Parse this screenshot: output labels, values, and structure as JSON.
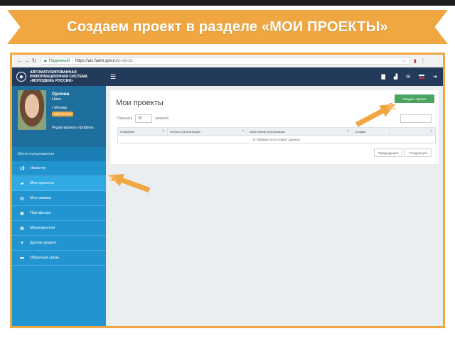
{
  "banner": {
    "title": "Создаем проект в разделе «МОИ ПРОЕКТЫ»"
  },
  "browser": {
    "secure_label": "Надежный",
    "url_host": "https://ais.fadm.gov.ru",
    "url_path": "/projects"
  },
  "app": {
    "brand_line1": "АВТОМАТИЗИРОВАННАЯ",
    "brand_line2": "ИНФОРМАЦИОННАЯ СИСТЕМА",
    "brand_line3": "«МОЛОДЕЖЬ РОССИИ»"
  },
  "profile": {
    "last_name": "Орлова",
    "first_name": "Нина",
    "city": "г Москва",
    "points": "250 баллов",
    "edit_link": "Редактировать профиль"
  },
  "sidebar": {
    "menu_header": "Меню пользователя",
    "items": [
      {
        "label": "Новости",
        "icon": "megaphone-icon"
      },
      {
        "label": "Мои проекты",
        "icon": "folder-icon",
        "active": true
      },
      {
        "label": "Мои заявки",
        "icon": "document-icon"
      },
      {
        "label": "Портфолио",
        "icon": "briefcase-icon"
      },
      {
        "label": "Мероприятия",
        "icon": "calendar-icon"
      },
      {
        "label": "Другие рецепт",
        "icon": "map-pin-icon"
      },
      {
        "label": "Обратная связь",
        "icon": "chat-icon"
      }
    ]
  },
  "main": {
    "title": "Мои проекты",
    "create_button": "Создать проект",
    "show_label": "Показать",
    "show_value": "25",
    "show_suffix": "записей",
    "columns": [
      "Название",
      "Начало реализации",
      "Окончание реализации",
      "Создан",
      ""
    ],
    "empty_text": "В таблице отсутствуют данные",
    "prev_button": "Предыдущая",
    "next_button": "Следующая"
  },
  "annotations": {
    "arrow1": "1.",
    "arrow2": "2."
  },
  "colors": {
    "accent": "#f0a741",
    "sidebar": "#2295d1",
    "appbar": "#233a5a",
    "create": "#4aa35f"
  }
}
